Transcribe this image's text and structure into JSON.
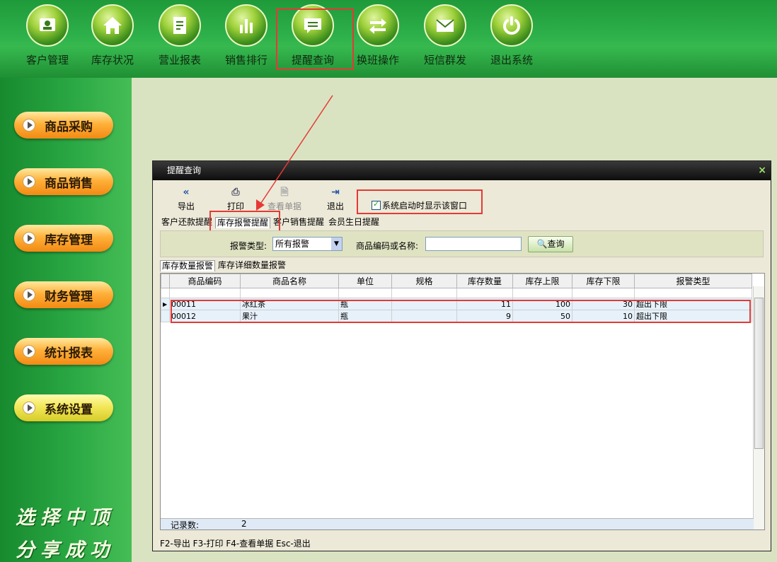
{
  "top_nav": [
    {
      "label": "客户管理",
      "icon": "customer-icon"
    },
    {
      "label": "库存状况",
      "icon": "home-icon"
    },
    {
      "label": "营业报表",
      "icon": "report-icon"
    },
    {
      "label": "销售排行",
      "icon": "bar-chart-icon"
    },
    {
      "label": "提醒查询",
      "icon": "message-icon"
    },
    {
      "label": "换班操作",
      "icon": "swap-icon"
    },
    {
      "label": "短信群发",
      "icon": "mail-icon"
    },
    {
      "label": "退出系统",
      "icon": "power-icon"
    }
  ],
  "sidebar": [
    {
      "label": "商品采购"
    },
    {
      "label": "商品销售"
    },
    {
      "label": "库存管理"
    },
    {
      "label": "财务管理"
    },
    {
      "label": "统计报表"
    },
    {
      "label": "系统设置"
    }
  ],
  "slogan": {
    "line1": "选择中顶",
    "line2": "分享成功"
  },
  "dialog": {
    "title": "提醒查询",
    "close": "×",
    "toolbar": {
      "export": "导出",
      "print": "打印",
      "view": "查看单据",
      "exit": "退出"
    },
    "startup_checkbox": "系统启动时显示该窗口",
    "tabs": [
      "客户还款提醒",
      "库存报警提醒",
      "客户销售提醒",
      "会员生日提醒"
    ],
    "search": {
      "type_label": "报警类型:",
      "type_value": "所有报警",
      "code_label": "商品编码或名称:",
      "code_value": "",
      "button": "查询"
    },
    "subtabs": [
      "库存数量报警",
      "库存详细数量报警"
    ],
    "columns": [
      "商品编码",
      "商品名称",
      "单位",
      "规格",
      "库存数量",
      "库存上限",
      "库存下限",
      "报警类型"
    ],
    "rows": [
      {
        "code": "00011",
        "name": "冰红茶",
        "unit": "瓶",
        "spec": "",
        "qty": "11",
        "upper": "100",
        "lower": "30",
        "type": "超出下限"
      },
      {
        "code": "00012",
        "name": "果汁",
        "unit": "瓶",
        "spec": "",
        "qty": "9",
        "upper": "50",
        "lower": "10",
        "type": "超出下限"
      }
    ],
    "record_label": "记录数:",
    "record_count": "2",
    "status": "F2-导出 F3-打印 F4-查看单据 Esc-退出"
  }
}
